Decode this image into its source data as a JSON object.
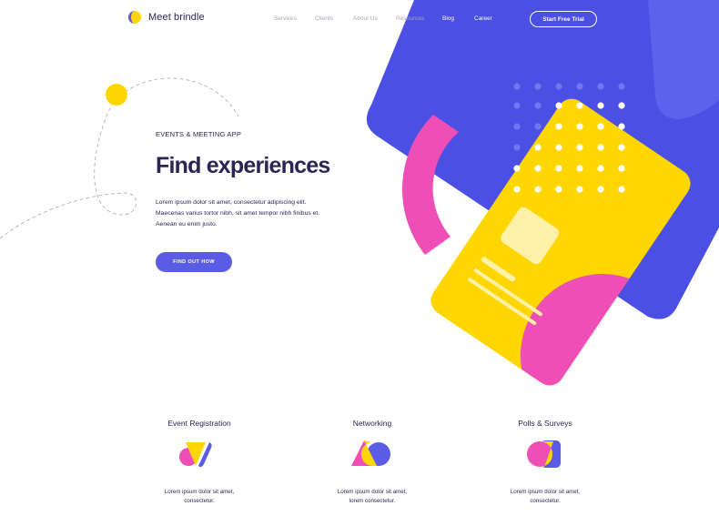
{
  "brand": {
    "name": "Meet brindle",
    "logo_icon": "brindle-logo-icon"
  },
  "nav": {
    "items": [
      "Services",
      "Clients",
      "About Us",
      "Resources",
      "Blog",
      "Career"
    ],
    "cta_label": "Start Free Trial"
  },
  "hero": {
    "eyebrow": "EVENTS & MEETING APP",
    "title": "Find experiences",
    "body_lines": [
      "Lorem ipsum dolor sit amet, consectetur adipiscing elit.",
      "Maecenas varius tortor nibh, sit amet tempor nibh finibus et.",
      "Aenean eu enim justo."
    ],
    "cta_label": "FIND OUT HOW"
  },
  "features": [
    {
      "title": "Event Registration",
      "icon": "event-registration-icon",
      "desc_lines": [
        "Lorem ipsum dolor sit amet,",
        "consectetur."
      ]
    },
    {
      "title": "Networking",
      "icon": "networking-icon",
      "desc_lines": [
        "Lorem ipsum dolor sit amet,",
        "lorem consectetur."
      ]
    },
    {
      "title": "Polls & Surveys",
      "icon": "polls-surveys-icon",
      "desc_lines": [
        "Lorem ipsum dolor sit amet,",
        "consectetur."
      ]
    }
  ],
  "colors": {
    "primary": "#5b5ce6",
    "indigo": "#4b4fe4",
    "yellow": "#ffd600",
    "pink": "#ee4eb5",
    "text": "#2a2552",
    "muted_nav": "#a5a7c0"
  }
}
